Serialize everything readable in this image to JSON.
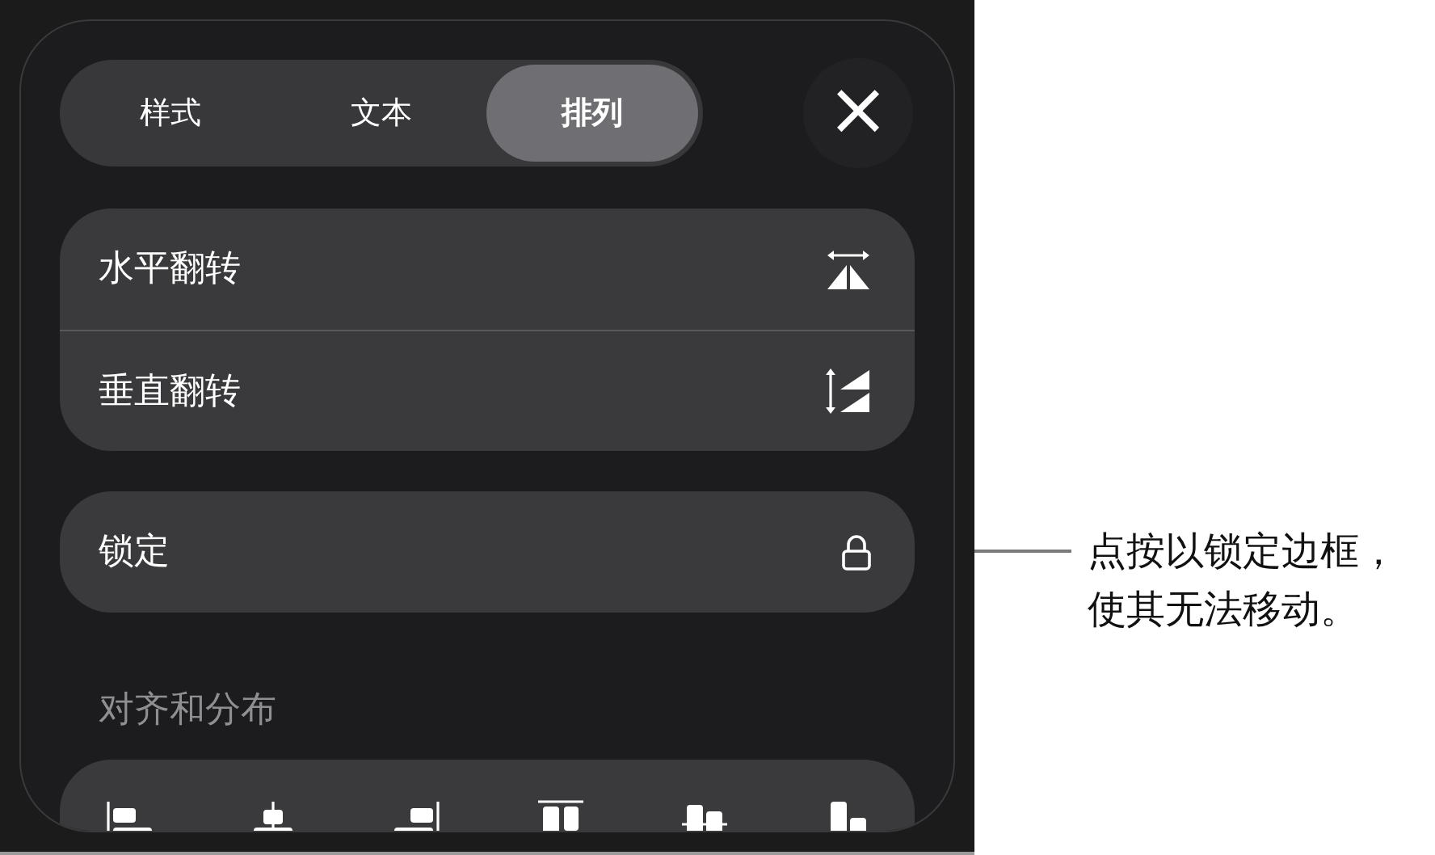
{
  "tabs": [
    {
      "label": "样式",
      "selected": false
    },
    {
      "label": "文本",
      "selected": false
    },
    {
      "label": "排列",
      "selected": true
    }
  ],
  "close": {
    "symbol": "×"
  },
  "flip_items": [
    {
      "label": "水平翻转",
      "kind": "horizontal"
    },
    {
      "label": "垂直翻转",
      "kind": "vertical"
    }
  ],
  "lock_item": {
    "label": "锁定",
    "kind": "lock"
  },
  "section_heading": "对齐和分布",
  "align_buttons": [
    {
      "kind": "left"
    },
    {
      "kind": "center"
    },
    {
      "kind": "right"
    },
    {
      "kind": "top"
    },
    {
      "kind": "middle"
    },
    {
      "kind": "bottom"
    }
  ],
  "callout": "点按以锁定边框，使其无法移动。"
}
